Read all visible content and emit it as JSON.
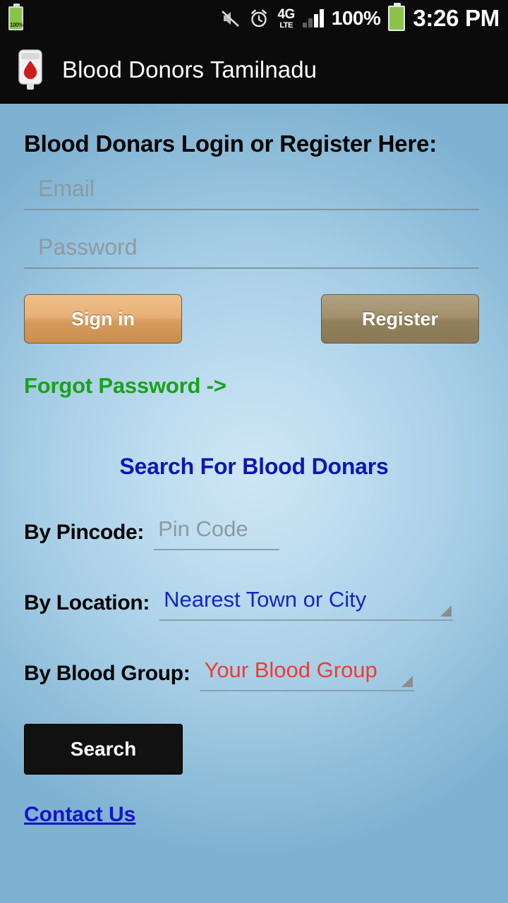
{
  "statusbar": {
    "battery_small_label": "100%",
    "network_type_primary": "4G",
    "network_type_secondary": "LTE",
    "battery_percent": "100%",
    "clock": "3:26 PM",
    "icons": {
      "battery_small": "battery-charging-icon",
      "mute": "mute-icon",
      "alarm": "alarm-clock-icon",
      "signal": "signal-bars-icon",
      "battery": "battery-icon"
    }
  },
  "appbar": {
    "icon": "blood-bag-icon",
    "title": "Blood Donors Tamilnadu"
  },
  "login": {
    "heading": "Blood Donars Login or Register Here:",
    "email": {
      "value": "",
      "placeholder": "Email"
    },
    "password": {
      "value": "",
      "placeholder": "Password"
    },
    "signin_label": "Sign in",
    "register_label": "Register",
    "forgot_label": "Forgot Password ->"
  },
  "search": {
    "heading": "Search For Blood Donars",
    "pincode": {
      "label": "By Pincode:",
      "value": "",
      "placeholder": "Pin Code"
    },
    "location": {
      "label": "By Location:",
      "value": "Nearest Town or City"
    },
    "blood_group": {
      "label": "By Blood Group:",
      "value": "Your Blood Group"
    },
    "search_label": "Search"
  },
  "footer": {
    "contact_label": "Contact Us"
  },
  "colors": {
    "accent_green": "#18a318",
    "accent_blue": "#0d17b4",
    "accent_red": "#ef3c2f",
    "link_blue": "#1414cc",
    "bar_black": "#0b0b0b"
  }
}
